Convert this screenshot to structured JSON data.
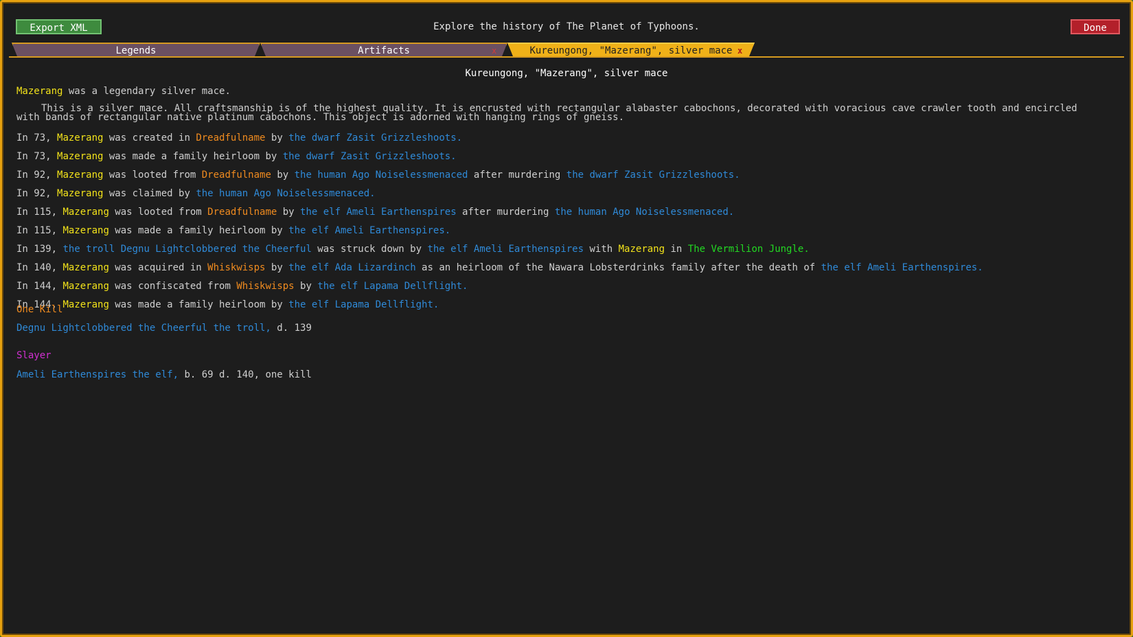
{
  "header": {
    "export_label": "Export XML",
    "title": "Explore the history of The Planet of Typhoons.",
    "done_label": "Done"
  },
  "tabs": [
    {
      "label": "Legends"
    },
    {
      "label": "Artifacts",
      "close": "x"
    },
    {
      "label": "Kureungong, \"Mazerang\", silver mace",
      "close": "x",
      "active": true
    }
  ],
  "page_heading": "Kureungong, \"Mazerang\", silver mace",
  "intro": {
    "name": "Mazerang",
    "rest": " was a legendary silver mace."
  },
  "description": "This is a silver mace. All craftsmanship is of the highest quality. It is encrusted with rectangular alabaster cabochons, decorated with voracious cave crawler tooth and encircled with bands of rectangular native platinum cabochons. This object is adorned with hanging rings of gneiss.",
  "events": [
    {
      "segs": [
        [
          "w",
          "In 73, "
        ],
        [
          "y",
          "Mazerang"
        ],
        [
          "w",
          " was created in "
        ],
        [
          "o",
          "Dreadfulname"
        ],
        [
          "w",
          " by "
        ],
        [
          "b",
          "the dwarf Zasit Grizzleshoots."
        ]
      ]
    },
    {
      "segs": [
        [
          "w",
          "In 73, "
        ],
        [
          "y",
          "Mazerang"
        ],
        [
          "w",
          " was made a family heirloom by "
        ],
        [
          "b",
          "the dwarf Zasit Grizzleshoots."
        ]
      ]
    },
    {
      "segs": [
        [
          "w",
          "In 92, "
        ],
        [
          "y",
          "Mazerang"
        ],
        [
          "w",
          " was looted from "
        ],
        [
          "o",
          "Dreadfulname"
        ],
        [
          "w",
          " by "
        ],
        [
          "b",
          "the human Ago Noiselessmenaced"
        ],
        [
          "w",
          " after murdering "
        ],
        [
          "b",
          "the dwarf Zasit Grizzleshoots."
        ]
      ]
    },
    {
      "segs": [
        [
          "w",
          "In 92, "
        ],
        [
          "y",
          "Mazerang"
        ],
        [
          "w",
          " was claimed by "
        ],
        [
          "b",
          "the human Ago Noiselessmenaced."
        ]
      ]
    },
    {
      "segs": [
        [
          "w",
          "In 115, "
        ],
        [
          "y",
          "Mazerang"
        ],
        [
          "w",
          " was looted from "
        ],
        [
          "o",
          "Dreadfulname"
        ],
        [
          "w",
          " by "
        ],
        [
          "b",
          "the elf Ameli Earthenspires"
        ],
        [
          "w",
          " after murdering "
        ],
        [
          "b",
          "the human Ago Noiselessmenaced."
        ]
      ]
    },
    {
      "segs": [
        [
          "w",
          "In 115, "
        ],
        [
          "y",
          "Mazerang"
        ],
        [
          "w",
          " was made a family heirloom by "
        ],
        [
          "b",
          "the elf Ameli Earthenspires."
        ]
      ]
    },
    {
      "segs": [
        [
          "w",
          "In 139, "
        ],
        [
          "b",
          "the troll Degnu Lightclobbered the Cheerful"
        ],
        [
          "w",
          " was struck down by "
        ],
        [
          "b",
          "the elf Ameli Earthenspires"
        ],
        [
          "w",
          " with "
        ],
        [
          "y",
          "Mazerang"
        ],
        [
          "w",
          " in "
        ],
        [
          "g",
          "The Vermilion Jungle."
        ]
      ]
    },
    {
      "segs": [
        [
          "w",
          "In 140, "
        ],
        [
          "y",
          "Mazerang"
        ],
        [
          "w",
          " was acquired in "
        ],
        [
          "o",
          "Whiskwisps"
        ],
        [
          "w",
          " by "
        ],
        [
          "b",
          "the elf Ada Lizardinch"
        ],
        [
          "w",
          " as an heirloom of the Nawara Lobsterdrinks family after the death of "
        ],
        [
          "b",
          "the elf Ameli Earthenspires."
        ]
      ]
    },
    {
      "segs": [
        [
          "w",
          "In 144, "
        ],
        [
          "y",
          "Mazerang"
        ],
        [
          "w",
          " was confiscated from "
        ],
        [
          "o",
          "Whiskwisps"
        ],
        [
          "w",
          " by "
        ],
        [
          "b",
          "the elf Lapama Dellflight."
        ]
      ]
    },
    {
      "segs": [
        [
          "w",
          "In 144, "
        ],
        [
          "y",
          "Mazerang"
        ],
        [
          "w",
          " was made a family heirloom by "
        ],
        [
          "b",
          "the elf Lapama Dellflight."
        ]
      ]
    }
  ],
  "kills": {
    "heading": "One Kill",
    "entry_name": "Degnu Lightclobbered the Cheerful the troll,",
    "entry_info": " d. 139"
  },
  "slayer": {
    "heading": "Slayer",
    "entry_name": "Ameli Earthenspires the elf,",
    "entry_info": " b. 69 d. 140, one kill"
  },
  "colors": {
    "border": "#e7a10f",
    "artifact": "#f2e21a",
    "site": "#f08b1f",
    "figure": "#2f8ad8",
    "region": "#22d822",
    "slayer": "#d02fd0"
  }
}
